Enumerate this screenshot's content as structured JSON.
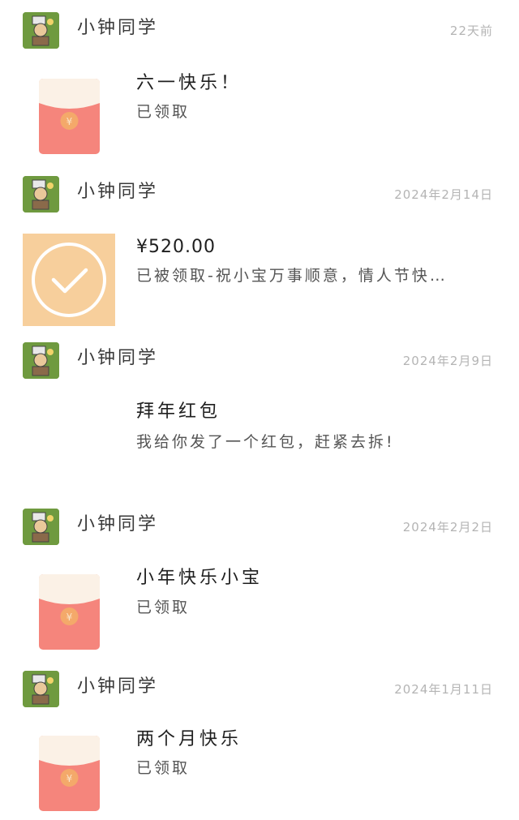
{
  "messages": [
    {
      "sender": "小钟同学",
      "time": "22天前",
      "title": "六一快乐！",
      "status": "已领取",
      "thumbnail_icon": "red-envelope-icon"
    },
    {
      "sender": "小钟同学",
      "time": "2024年2月14日",
      "title": "¥520.00",
      "status": "已被领取-祝小宝万事顺意，情人节快…",
      "thumbnail_icon": "check-circle-icon"
    },
    {
      "sender": "小钟同学",
      "time": "2024年2月9日",
      "title": "拜年红包",
      "status": "我给你发了一个红包，赶紧去拆!",
      "thumbnail_icon": ""
    },
    {
      "sender": "小钟同学",
      "time": "2024年2月2日",
      "title": "小年快乐小宝",
      "status": "已领取",
      "thumbnail_icon": "red-envelope-icon"
    },
    {
      "sender": "小钟同学",
      "time": "2024年1月11日",
      "title": "两个月快乐",
      "status": "已领取",
      "thumbnail_icon": "red-envelope-icon"
    }
  ],
  "colors": {
    "envelope_red": "#f5857c",
    "envelope_flap": "#fbf1e6",
    "coin": "#f4a96a",
    "transfer_bg": "#f7cf9c",
    "avatar_green": "#6f9a3f"
  }
}
